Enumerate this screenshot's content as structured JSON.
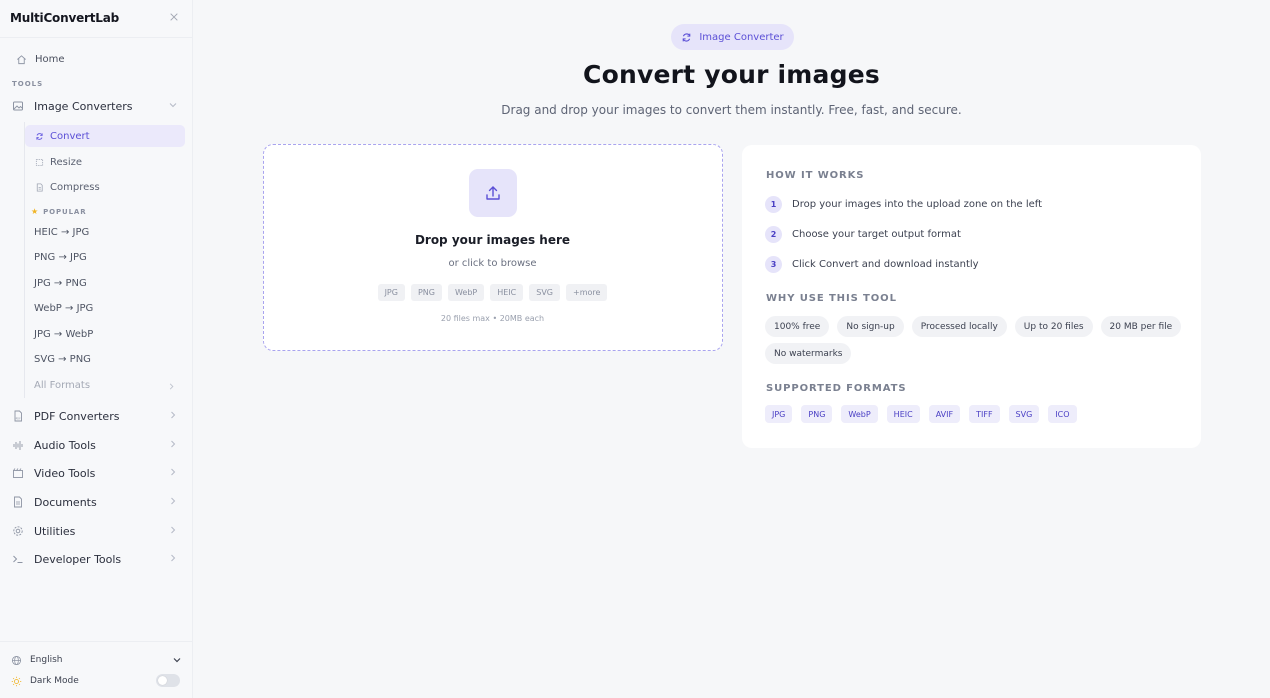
{
  "app": {
    "brand": "MultiConvertLab"
  },
  "sidebar": {
    "home": "Home",
    "section_tools": "TOOLS",
    "image_converters": {
      "label": "Image Converters",
      "subitems": [
        "Convert",
        "Resize",
        "Compress"
      ],
      "active": "Convert",
      "popular_label": "POPULAR",
      "popular": [
        "HEIC → JPG",
        "PNG → JPG",
        "JPG → PNG",
        "WebP → JPG",
        "JPG → WebP",
        "SVG → PNG"
      ],
      "all_formats": "All Formats"
    },
    "groups": [
      {
        "label": "PDF Converters",
        "icon": "pdf-icon"
      },
      {
        "label": "Audio Tools",
        "icon": "audio-icon"
      },
      {
        "label": "Video Tools",
        "icon": "video-icon"
      },
      {
        "label": "Documents",
        "icon": "document-icon"
      },
      {
        "label": "Utilities",
        "icon": "gear-icon"
      },
      {
        "label": "Developer Tools",
        "icon": "terminal-icon"
      }
    ],
    "language": "English",
    "dark_mode": "Dark Mode",
    "dark_mode_on": false
  },
  "main": {
    "badge": "Image Converter",
    "title": "Convert your images",
    "subtitle": "Drag and drop your images to convert them instantly. Free, fast, and secure.",
    "dropzone": {
      "title": "Drop your images here",
      "subtitle": "or click to browse",
      "formats": [
        "JPG",
        "PNG",
        "WebP",
        "HEIC",
        "SVG",
        "+more"
      ],
      "limit": "20 files max • 20MB each"
    },
    "how_it_works": {
      "label": "HOW IT WORKS",
      "steps": [
        {
          "num": "1",
          "text": "Drop your images into the upload zone on the left"
        },
        {
          "num": "2",
          "text": "Choose your target output format"
        },
        {
          "num": "3",
          "text": "Click Convert and download instantly"
        }
      ]
    },
    "why_use": {
      "label": "WHY USE THIS TOOL",
      "features": [
        "100% free",
        "No sign-up",
        "Processed locally",
        "Up to 20 files",
        "20 MB per file",
        "No watermarks"
      ]
    },
    "supported": {
      "label": "SUPPORTED FORMATS",
      "formats": [
        "JPG",
        "PNG",
        "WebP",
        "HEIC",
        "AVIF",
        "TIFF",
        "SVG",
        "ICO"
      ]
    }
  },
  "colors": {
    "accent": "#5b4fd6",
    "accent_soft": "#e6e4fa",
    "popular_star": "#f0b323"
  }
}
